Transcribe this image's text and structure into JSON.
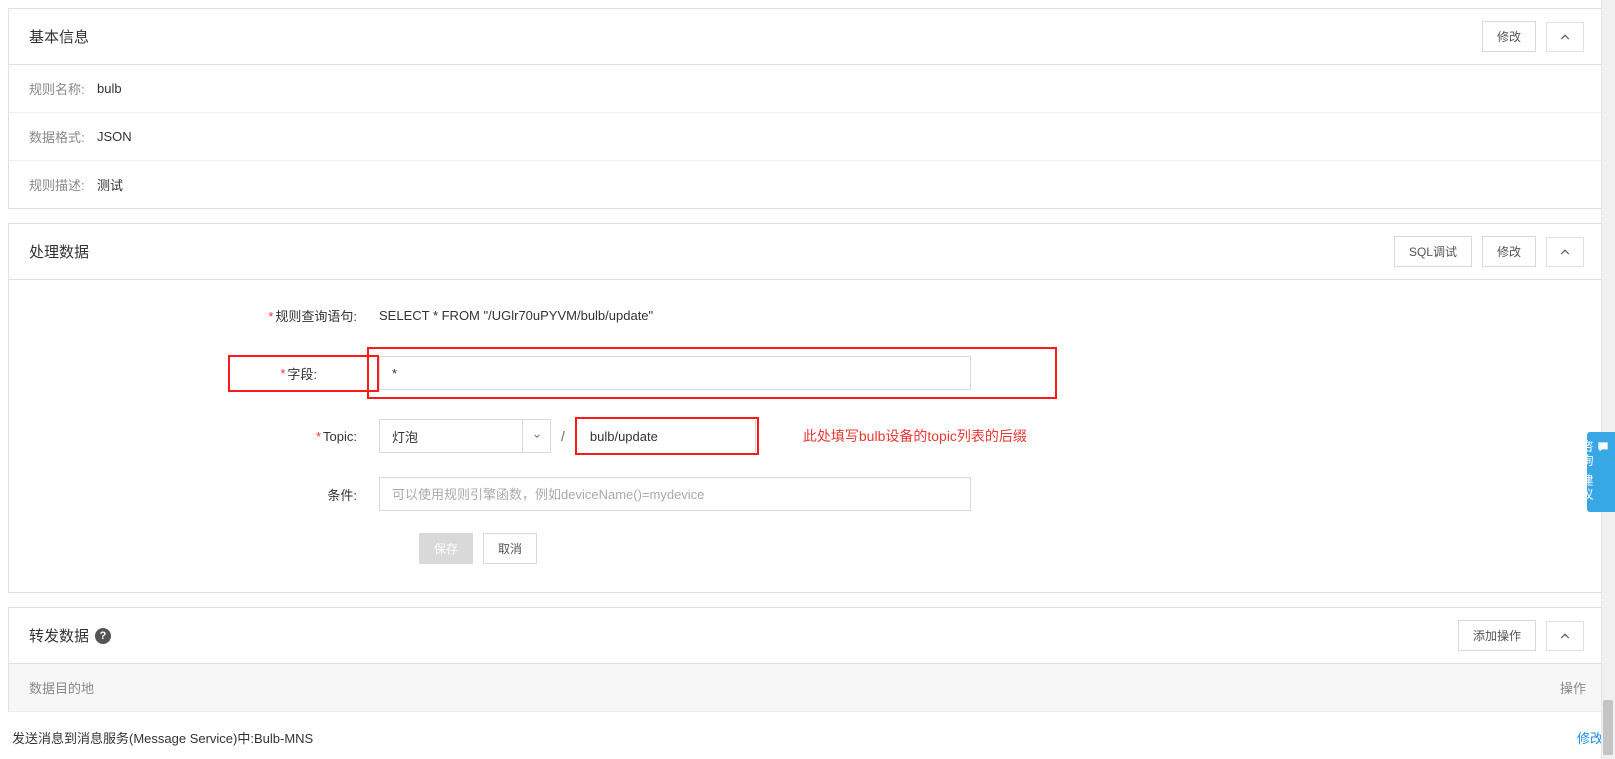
{
  "basic_info": {
    "title": "基本信息",
    "edit_btn": "修改",
    "rows": {
      "name_label": "规则名称:",
      "name_value": "bulb",
      "format_label": "数据格式:",
      "format_value": "JSON",
      "desc_label": "规则描述:",
      "desc_value": "测试"
    }
  },
  "process_data": {
    "title": "处理数据",
    "sql_debug_btn": "SQL调试",
    "edit_btn": "修改",
    "query_label": "规则查询语句:",
    "query_value": "SELECT * FROM \"/UGlr70uPYVM/bulb/update\"",
    "field_label": "字段:",
    "field_value": "*",
    "topic_label": "Topic:",
    "topic_select_value": "灯泡",
    "topic_input_value": "bulb/update",
    "topic_note": "此处填写bulb设备的topic列表的后缀",
    "condition_label": "条件:",
    "condition_placeholder": "可以使用规则引擎函数，例如deviceName()=mydevice",
    "save_btn": "保存",
    "cancel_btn": "取消"
  },
  "forward_data": {
    "title": "转发数据",
    "add_btn": "添加操作",
    "col_dest": "数据目的地",
    "col_action": "操作",
    "row_text": "发送消息到消息服务(Message Service)中:Bulb-MNS",
    "row_action": "修改"
  },
  "float_tab_text": "咨询·建议"
}
